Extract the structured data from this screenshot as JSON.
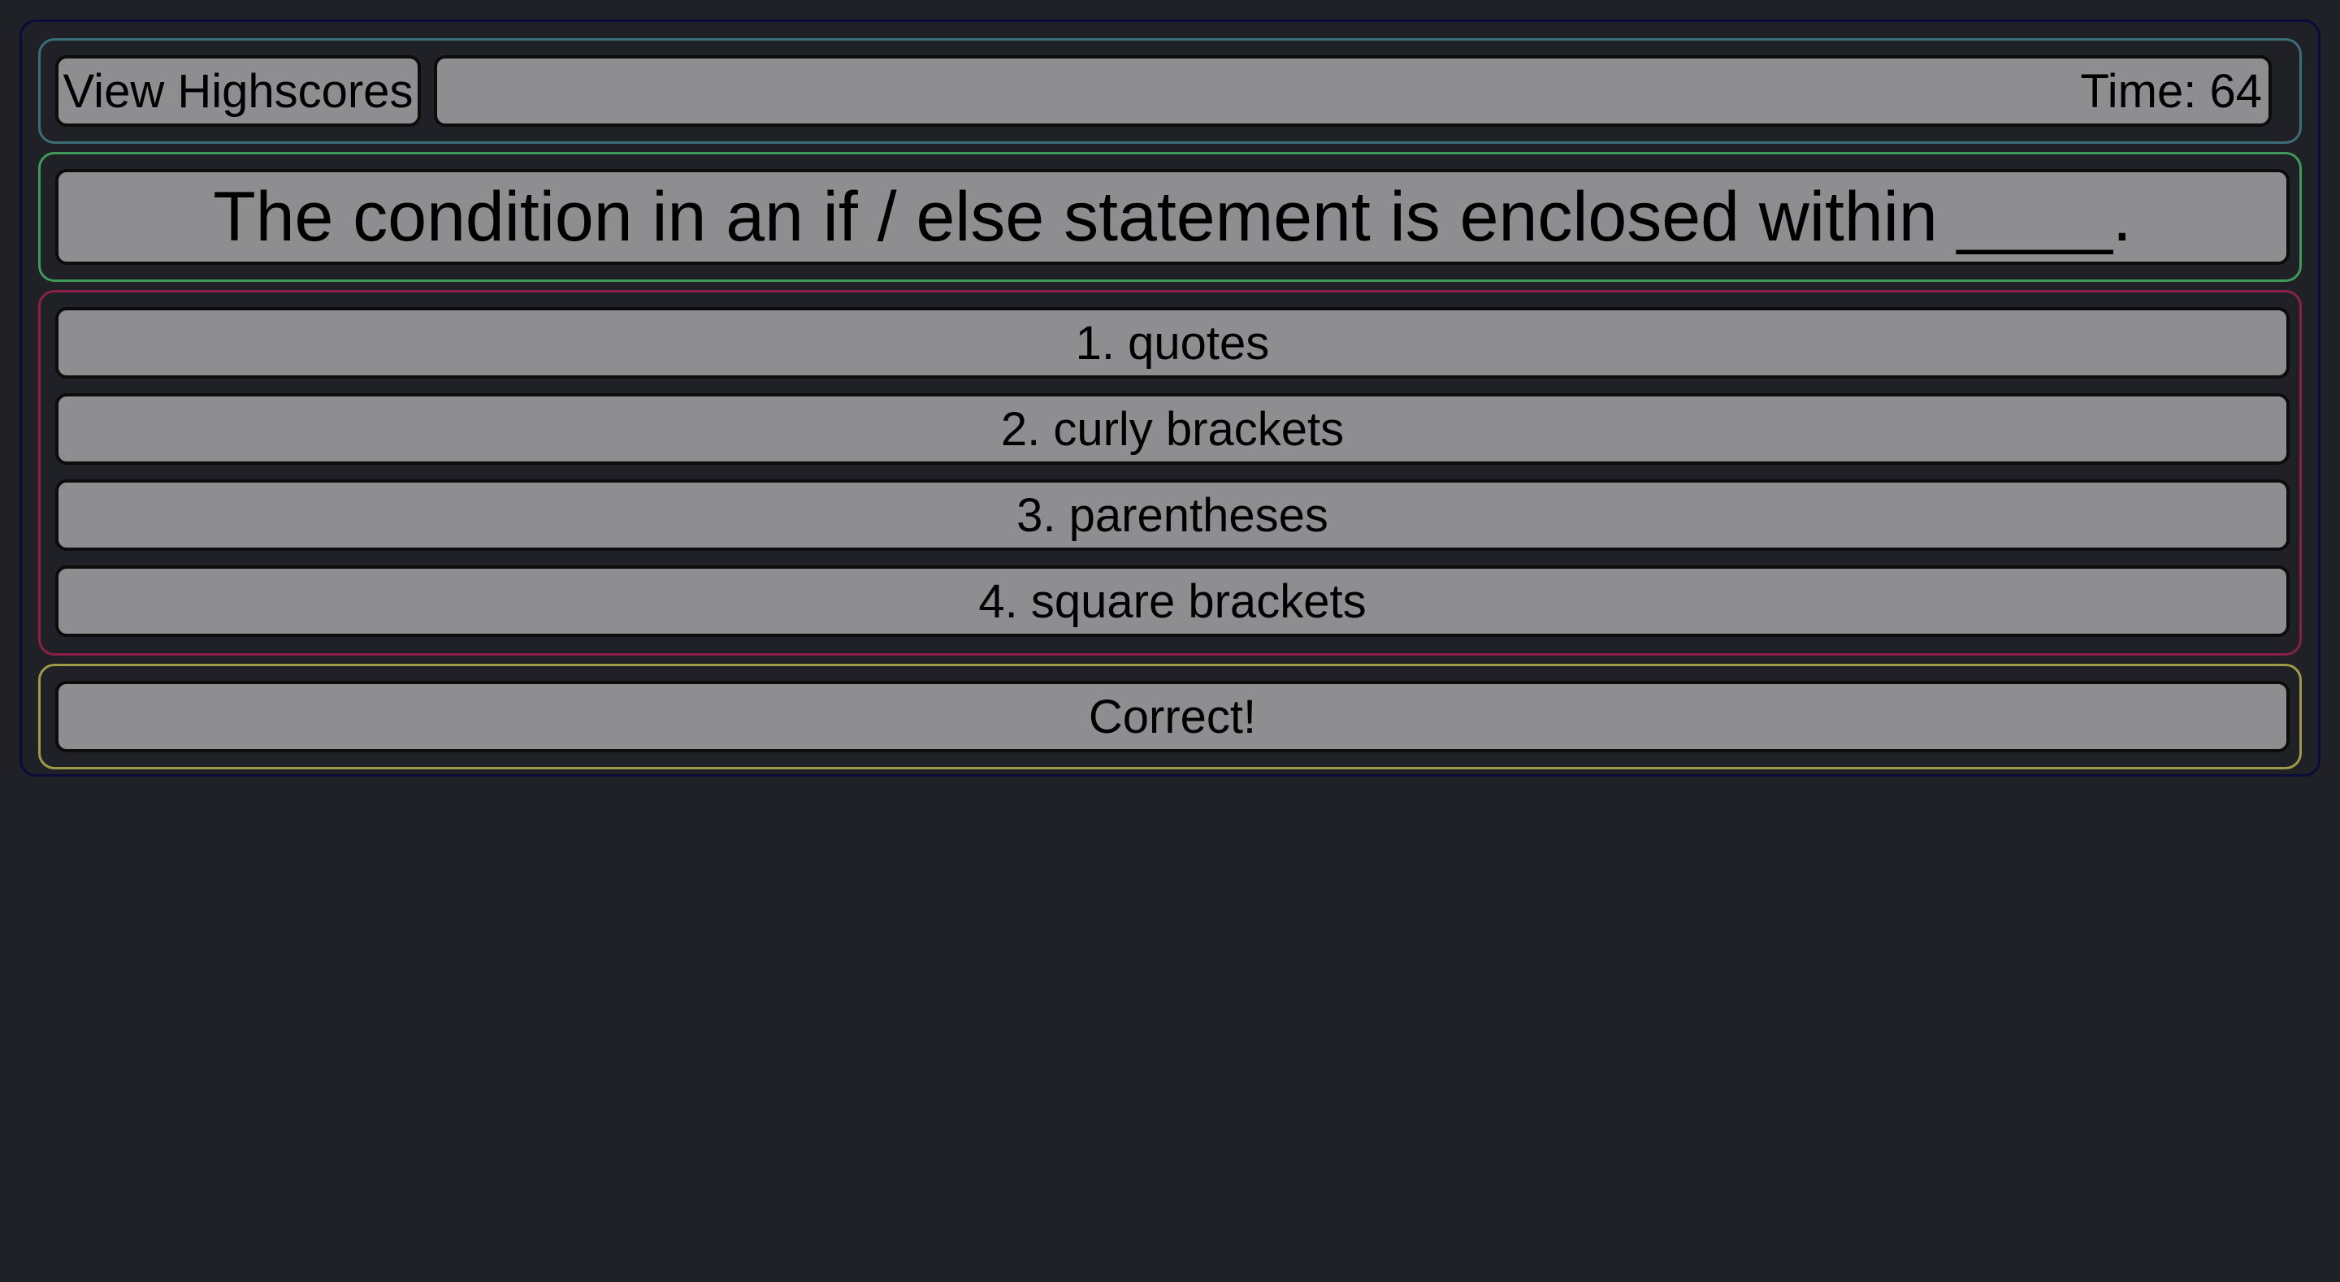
{
  "header": {
    "highscores_label": "View Highscores",
    "timer_text": "Time: 64"
  },
  "question": {
    "text": "The condition in an if / else statement is enclosed within ____."
  },
  "answers": [
    {
      "label": "1. quotes"
    },
    {
      "label": "2. curly brackets"
    },
    {
      "label": "3. parentheses"
    },
    {
      "label": "4. square brackets"
    }
  ],
  "feedback": {
    "text": "Correct!"
  },
  "colors": {
    "background": "#202127",
    "box_fill": "#8e8e90",
    "header_border": "#3c6e78",
    "question_border": "#3f9a5a",
    "answers_border": "#8a1f4a",
    "feedback_border": "#9e9a4a"
  }
}
